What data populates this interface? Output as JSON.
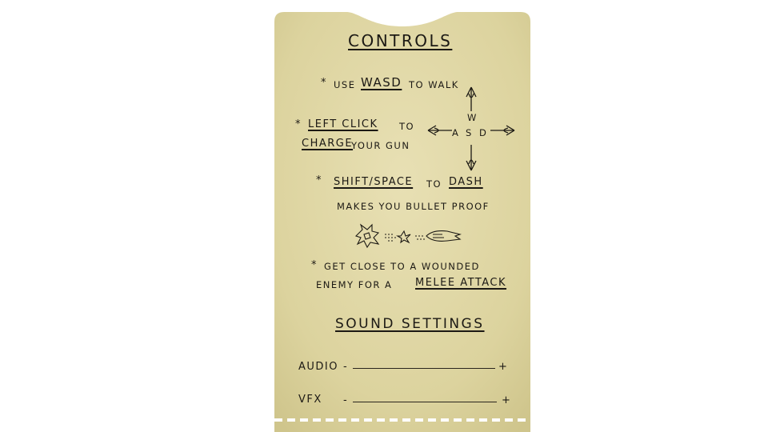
{
  "controls": {
    "title": "CONTROLS",
    "walk": {
      "star": "*",
      "use": "USE",
      "keys": "WASD",
      "rest": "TO WALK"
    },
    "charge": {
      "star": "*",
      "click": "LEFT CLICK",
      "to": "TO",
      "charge": "CHARGE",
      "rest": "YOUR GUN"
    },
    "dash": {
      "star": "*",
      "keys": "SHIFT/SPACE",
      "to": "TO",
      "dash": "DASH",
      "note": "MAKES YOU BULLET PROOF"
    },
    "melee": {
      "star": "*",
      "line1": "GET CLOSE TO A WOUNDED",
      "line2_pre": "ENEMY FOR A",
      "attack": "MELEE ATTACK"
    },
    "wasd_diagram": {
      "w": "W",
      "a": "A",
      "s": "S",
      "d": "D"
    }
  },
  "sound_settings": {
    "title": "SOUND SETTINGS",
    "audio": {
      "label": "AUDIO",
      "minus": "-",
      "plus": "+"
    },
    "vfx": {
      "label": "VFX",
      "minus": "-",
      "plus": "+"
    }
  },
  "colors": {
    "paper": "#d8cf9a",
    "paper_light": "#e6deb0",
    "ink": "#1c1914"
  },
  "icons": [
    "arrow-up-icon",
    "arrow-down-icon",
    "arrow-left-icon",
    "arrow-right-icon",
    "dash-burst-icon"
  ]
}
